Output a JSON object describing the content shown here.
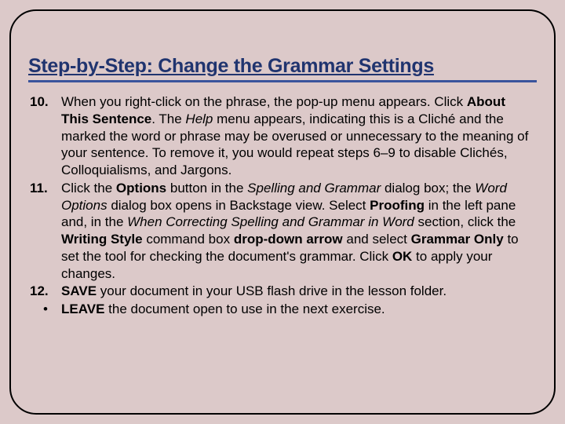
{
  "title": "Step-by-Step: Change the Grammar Settings",
  "items": [
    {
      "marker": "10.",
      "segments": [
        {
          "t": " When you right-click on the phrase, the pop-up menu appears. Click "
        },
        {
          "t": "About This Sentence",
          "b": true
        },
        {
          "t": ". The "
        },
        {
          "t": "Help",
          "i": true
        },
        {
          "t": " menu appears, indicating this is a Cliché and the marked the word or phrase may be overused or unnecessary to the meaning of your sentence. To remove it, you would repeat steps 6–9 to disable Clichés, Colloquialisms, and Jargons."
        }
      ]
    },
    {
      "marker": "11.",
      "segments": [
        {
          "t": " Click the "
        },
        {
          "t": "Options",
          "b": true
        },
        {
          "t": " button in the "
        },
        {
          "t": "Spelling and Grammar",
          "i": true
        },
        {
          "t": " dialog box; the "
        },
        {
          "t": "Word Options",
          "i": true
        },
        {
          "t": " dialog box opens in Backstage view. Select "
        },
        {
          "t": "Proofing",
          "b": true
        },
        {
          "t": " in the left pane and, in the "
        },
        {
          "t": "When Correcting Spelling and Grammar in Word",
          "i": true
        },
        {
          "t": " section, click the "
        },
        {
          "t": "Writing Style",
          "b": true
        },
        {
          "t": " command box "
        },
        {
          "t": "drop-down arrow",
          "b": true
        },
        {
          "t": " and select "
        },
        {
          "t": "Grammar Only",
          "b": true
        },
        {
          "t": " to set the tool for checking the document's grammar. Click "
        },
        {
          "t": "OK",
          "b": true
        },
        {
          "t": " to apply your changes."
        }
      ]
    },
    {
      "marker": "12.",
      "segments": [
        {
          "t": " "
        },
        {
          "t": "SAVE",
          "b": true
        },
        {
          "t": " your document in your USB flash drive in the lesson folder."
        }
      ]
    },
    {
      "marker": "•",
      "bullet": true,
      "segments": [
        {
          "t": "LEAVE",
          "b": true
        },
        {
          "t": " the document open to use in the next exercise."
        }
      ]
    }
  ]
}
